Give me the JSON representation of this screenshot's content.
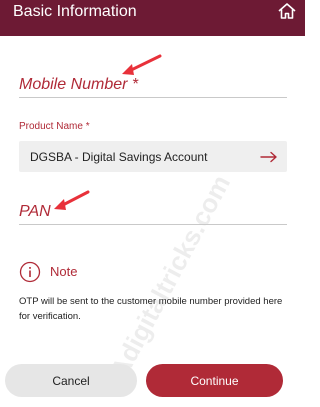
{
  "header": {
    "title": "Basic Information",
    "home_icon": "home-icon",
    "background": "#6d1a34"
  },
  "form": {
    "mobile_number_label": "Mobile Number *",
    "product_name_label": "Product Name *",
    "product_name_value": "DGSBA - Digital Savings Account",
    "pan_label": "PAN"
  },
  "note": {
    "icon": "info-icon",
    "label": "Note",
    "text": "OTP will be sent to the customer mobile number provided here for verification."
  },
  "buttons": {
    "cancel_label": "Cancel",
    "continue_label": "Continue"
  },
  "watermark": "Adigitaltricks.com",
  "colors": {
    "accent": "#b02a37",
    "arrow": "#e8313a"
  }
}
